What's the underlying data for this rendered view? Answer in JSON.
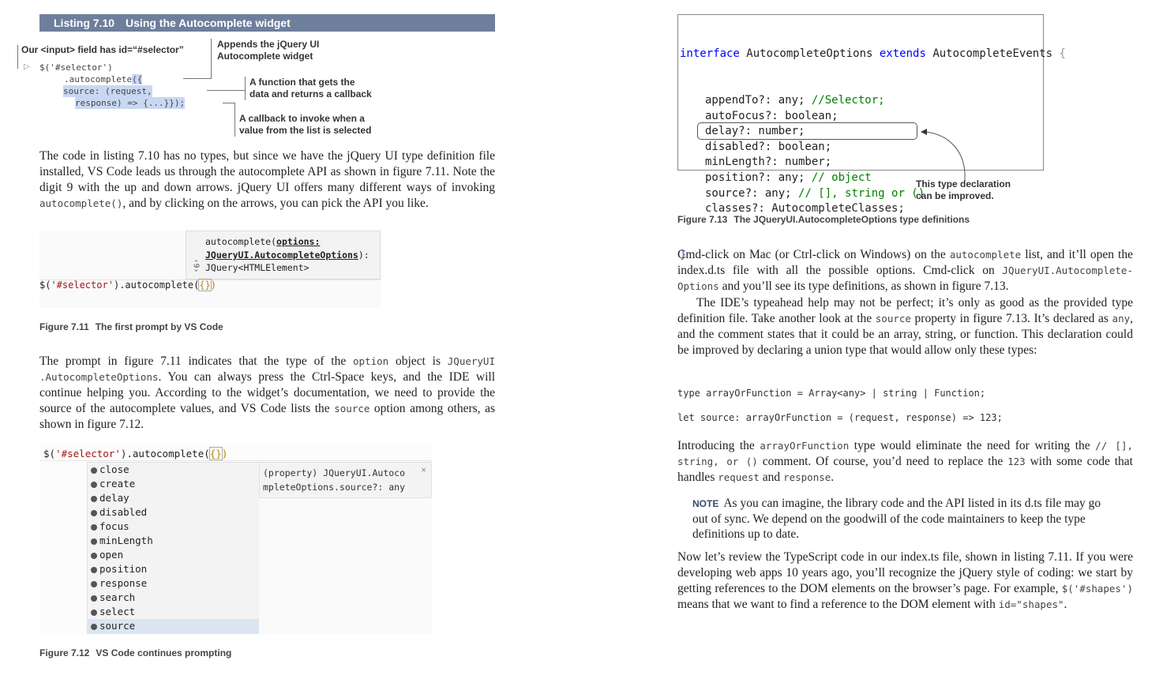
{
  "listing": {
    "number": "Listing 7.10",
    "title": "Using the Autocomplete widget",
    "annotation_input": "Our <input> field has id=“#selector”",
    "annotation_append_1": "Appends the jQuery UI",
    "annotation_append_2": "Autocomplete widget",
    "annotation_function_1": "A function that gets the",
    "annotation_function_2": "data and returns a callback",
    "annotation_callback_1": "A callback to invoke when a",
    "annotation_callback_2": "value from the list is selected",
    "code_line1": "$('#selector')",
    "code_line2_pre": ".autocomplete",
    "code_line2_hl": "({",
    "code_line3_hl": "source: (request,",
    "code_line4_hl": "response) => {...}});"
  },
  "left": {
    "para1_a": "The code in listing 7.10 has no types, but since we have the jQuery UI type definition file installed, VS Code leads us through the autocomplete API as shown in figure 7.11. Note the digit 9 with the up and down arrows. jQuery UI offers many different ways of invoking ",
    "para1_code": "autocomplete()",
    "para1_b": ", and by clicking on the arrows, you can pick the API you like.",
    "fig711": {
      "sig_line1_a": "autocomplete(",
      "sig_line1_b": "options:",
      "sig_line2": "JQueryUI.AutocompleteOptions",
      "sig_line2_end": "):",
      "sig_line3": "JQuery<HTMLElement>",
      "overload_count": "9",
      "code_pre": "$(",
      "code_str": "'#selector'",
      "code_mid": ").autocomplete(",
      "code_brace": "{}",
      "code_end": ")",
      "caption_num": "Figure 7.11",
      "caption_text": "The first prompt by VS Code"
    },
    "para2_a": "The prompt in figure 7.11 indicates that the type of the ",
    "para2_code1": "option",
    "para2_b": " object is ",
    "para2_code2": "JQueryUI .AutocompleteOptions",
    "para2_c": ". You can always press the Ctrl-Space keys, and the IDE will continue helping you. According to the widget’s documentation, we need to provide the source of the autocomplete values, and VS Code lists the ",
    "para2_code3": "source",
    "para2_d": " option among others, as shown in figure 7.12.",
    "fig712": {
      "code_pre": "$(",
      "code_str": "'#selector'",
      "code_mid": ").autocomplete(",
      "code_brace": "{}",
      "code_end": ")",
      "items": [
        "close",
        "create",
        "delay",
        "disabled",
        "focus",
        "minLength",
        "open",
        "position",
        "response",
        "search",
        "select",
        "source"
      ],
      "detail_line1": "(property) JQueryUI.Autoco",
      "detail_line2": "mpleteOptions.source?: any",
      "close_glyph": "×",
      "caption_num": "Figure 7.12",
      "caption_text": "VS Code continues prompting"
    }
  },
  "right": {
    "fig713": {
      "line1_kw1": "interface",
      "line1_name": " AutocompleteOptions ",
      "line1_kw2": "extends",
      "line1_rest": " AutocompleteEvents ",
      "line1_brace": "{",
      "lines": [
        {
          "prop": "appendTo?: any; ",
          "comment": "//Selector;"
        },
        {
          "prop": "autoFocus?: boolean;",
          "comment": ""
        },
        {
          "prop": "delay?: number;",
          "comment": ""
        },
        {
          "prop": "disabled?: boolean;",
          "comment": ""
        },
        {
          "prop": "minLength?: number;",
          "comment": ""
        },
        {
          "prop": "position?: any; ",
          "comment": "// object"
        },
        {
          "prop": "source?: any; ",
          "comment": "// [], string or ()"
        },
        {
          "prop": "classes?: AutocompleteClasses;",
          "comment": ""
        }
      ],
      "close_brace": "}",
      "callout_1": "This type declaration",
      "callout_2": "can be improved.",
      "caption_num": "Figure 7.13",
      "caption_text": "The JQueryUI.AutocompleteOptions type definitions"
    },
    "para3_a": "Cmd-click on Mac (or Ctrl-click on Windows) on the ",
    "para3_code1": "autocomplete",
    "para3_b": " list, and it’ll open the index.d.ts file with all the possible options. Cmd-click on ",
    "para3_code2": "JQueryUI.Autocomplete-Options",
    "para3_c": " and you’ll see its type definitions, as shown in figure 7.13.",
    "para4_a": "The IDE’s typeahead help may not be perfect; it’s only as good as the provided type definition file. Take another look at the ",
    "para4_code1": "source",
    "para4_b": " property in figure 7.13. It’s declared as ",
    "para4_code2": "any",
    "para4_c": ", and the comment states that it could be an array, string, or function. This declaration could be improved by declaring a union type that would allow only these types:",
    "code1": "type arrayOrFunction = Array<any> | string | Function;",
    "code2": "let source: arrayOrFunction = (request, response) => 123;",
    "para5_a": "Introducing the ",
    "para5_code1": "arrayOrFunction",
    "para5_b": " type would eliminate the need for writing the ",
    "para5_code2": "// [], string, or ()",
    "para5_c": " comment. Of course, you’d need to replace the ",
    "para5_code3": "123",
    "para5_d": " with some code that handles ",
    "para5_code4": "request",
    "para5_e": " and ",
    "para5_code5": "response",
    "para5_f": ".",
    "note_label": "NOTE",
    "note_text": "As you can imagine, the library code and the API listed in its d.ts file may go out of sync. We depend on the goodwill of the code maintainers to keep the type definitions up to date.",
    "para6_a": "Now let’s review the TypeScript code in our index.ts file, shown in listing 7.11. If you were developing web apps 10 years ago, you’ll recognize the jQuery style of coding: we start by getting references to the DOM elements on the browser’s page. For example, ",
    "para6_code1": "$('#shapes')",
    "para6_b": " means that we want to find a reference to the DOM element with ",
    "para6_code2": "id=\"shapes\"",
    "para6_c": "."
  }
}
